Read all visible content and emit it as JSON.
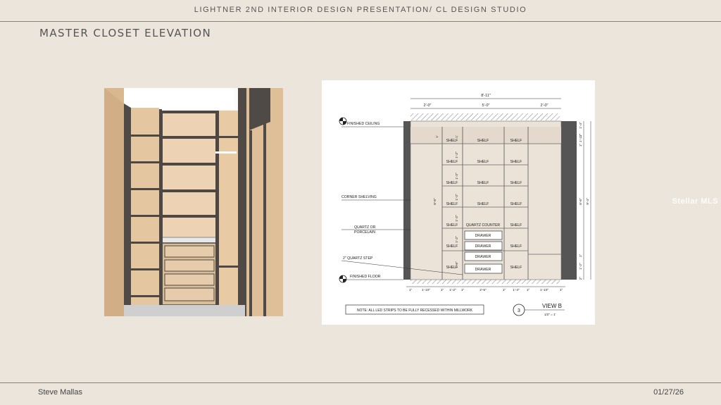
{
  "header": {
    "title": "LIGHTNER 2ND INTERIOR DESIGN PRESENTATION/ CL DESIGN STUDIO"
  },
  "page_title": "MASTER CLOSET ELEVATION",
  "footer": {
    "author": "Steve Mallas",
    "date": "01/27/26"
  },
  "watermark": "Stellar MLS",
  "drawing": {
    "top_dims": {
      "overall": "8'-11\"",
      "left": "2'-0\"",
      "center": "5'-0\"",
      "right": "2'-0\""
    },
    "labels": {
      "ceiling": "FINISHED CEILING",
      "corner": "CORNER SHELVING",
      "quartz_line1": "QUARTZ OR",
      "quartz_line2": "PORCELAIN",
      "step": "2\" QUARTZ STEP",
      "floor": "FINISHED FLOOR"
    },
    "shelf": "SHELF",
    "counter": "QUARTZ COUNTER",
    "drawer": "DRAWER",
    "left_dims": [
      "1'",
      "1'",
      "1'-2\"",
      "1'-2\"",
      "1'-2\"",
      "1'-2\"",
      "1'-2\"",
      "1'-6\""
    ],
    "left_height": "6'-6\"",
    "right_dims": [
      "1'-4\"",
      "1\"",
      "1'-11\"",
      "1\"",
      "6'-6\"",
      "1\"",
      "1'-2\"",
      "2\""
    ],
    "overall_height": "9'-4\"",
    "bottom_dims": [
      "1\"",
      "1'-10\"",
      "1\"",
      "1'-2\"",
      "1\"",
      "2'-5\"",
      "1\"",
      "1'-4\"",
      "1\"",
      "1'-10\"",
      "1\""
    ],
    "note": "NOTE: ALL LED STRIPS TO BE FULLY RECESSED WITHIN MILLWORK",
    "view_number": "3",
    "view_title": "VIEW B",
    "view_scale": "1/2\" = 1'"
  }
}
